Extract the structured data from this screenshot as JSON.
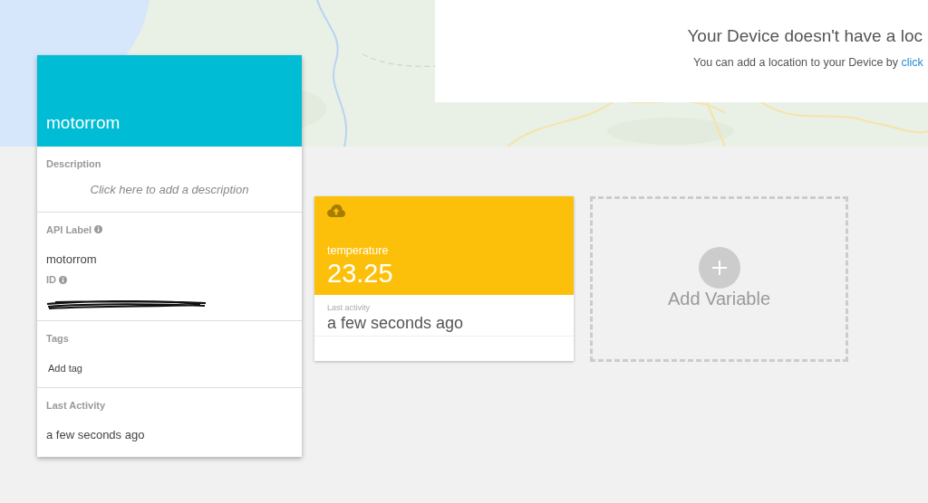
{
  "notice": {
    "title": "Your Device doesn't have a loc",
    "text": "You can add a location to your Device by ",
    "link": "click"
  },
  "device": {
    "name": "motorrom",
    "sections": [
      {
        "fields": [
          {
            "kind": "placeholder",
            "label": "Description",
            "text": "Click here to add a description"
          }
        ]
      },
      {
        "fields": [
          {
            "kind": "value",
            "label": "API Label",
            "info": true,
            "text": "motorrom"
          },
          {
            "kind": "redacted",
            "label": "ID",
            "info": true
          }
        ]
      },
      {
        "fields": [
          {
            "kind": "action",
            "label": "Tags",
            "text": "Add tag"
          }
        ]
      },
      {
        "fields": [
          {
            "kind": "value",
            "label": "Last Activity",
            "info": false,
            "text": "a few seconds ago"
          }
        ]
      }
    ]
  },
  "variables": [
    {
      "name": "temperature",
      "value": "23.25",
      "activity_label": "Last activity",
      "activity": "a few seconds ago"
    }
  ],
  "add_tile": {
    "label": "Add Variable"
  }
}
